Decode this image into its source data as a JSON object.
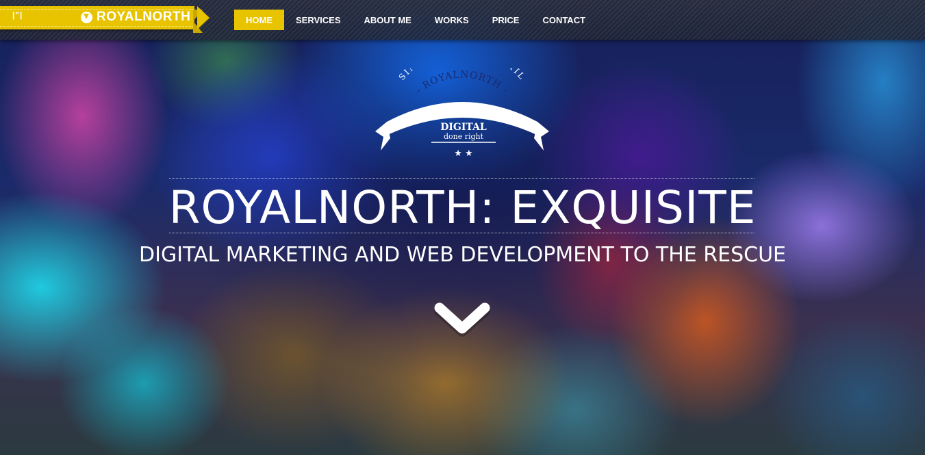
{
  "header": {
    "corner_icon_text": "|\"|",
    "brand_name": "ROYALNORTH",
    "brand_color": "#e8c300"
  },
  "nav": {
    "items": [
      {
        "label": "HOME",
        "active": true
      },
      {
        "label": "SERVICES",
        "active": false
      },
      {
        "label": "ABOUT ME",
        "active": false
      },
      {
        "label": "WORKS",
        "active": false
      },
      {
        "label": "PRICE",
        "active": false
      },
      {
        "label": "CONTACT",
        "active": false
      }
    ]
  },
  "emblem": {
    "motto": "SINE - LABORE - NIHIL",
    "banner_text": "- ROYALNORTH -",
    "line1": "DIGITAL",
    "line2": "done right"
  },
  "hero": {
    "title": "ROYALNORTH: EXQUISITE",
    "subtitle": "DIGITAL MARKETING AND WEB DEVELOPMENT TO THE RESCUE"
  },
  "scroll_icon": "chevron-down-icon"
}
